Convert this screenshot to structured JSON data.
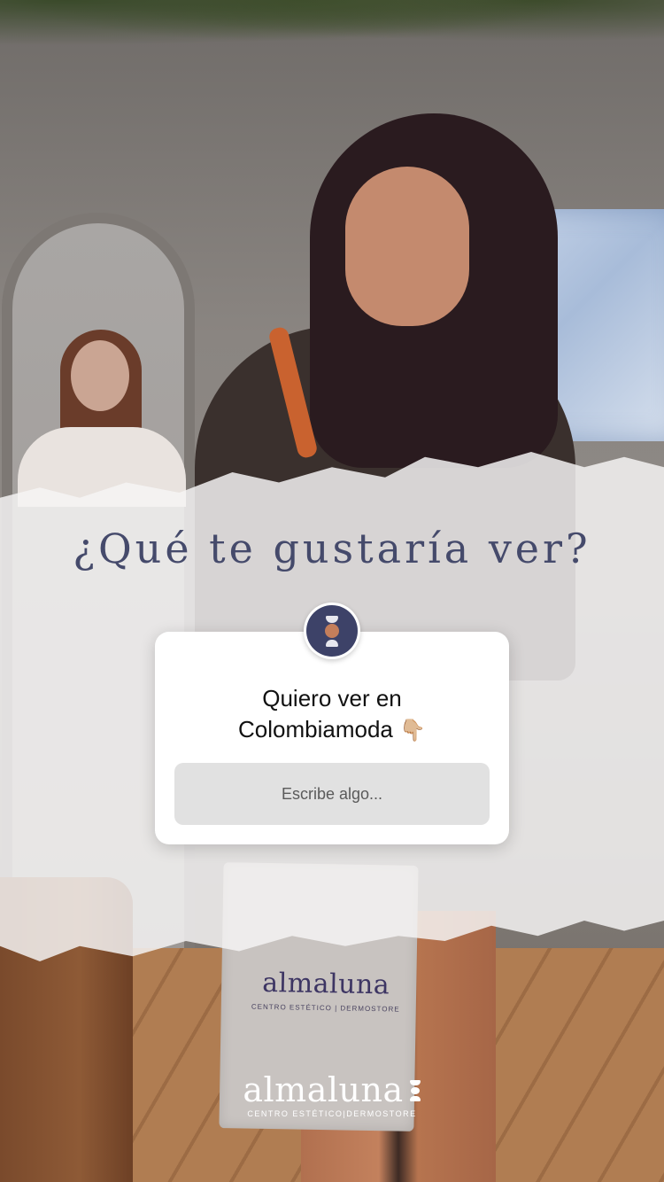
{
  "story": {
    "question_heading": "¿Qué te gustaría ver?",
    "sticker": {
      "prompt_line1": "Quiero ver en",
      "prompt_line2": "Colombiamoda",
      "prompt_emoji": "👇🏼",
      "input_placeholder": "Escribe algo..."
    },
    "bag": {
      "brand": "almaluna",
      "tagline": "CENTRO ESTÉTICO | DERMOSTORE"
    },
    "logo": {
      "wordmark": "almaluna",
      "tagline": "CENTRO ESTÉTICO|DERMOSTORE"
    }
  },
  "colors": {
    "heading_text": "#454a6b",
    "avatar_bg": "#3d4268",
    "avatar_accent": "#c47e5b",
    "input_bg": "#e1e1e1"
  },
  "icons": {
    "avatar": "brand-avatar-icon",
    "pointer": "pointing-down-emoji"
  }
}
